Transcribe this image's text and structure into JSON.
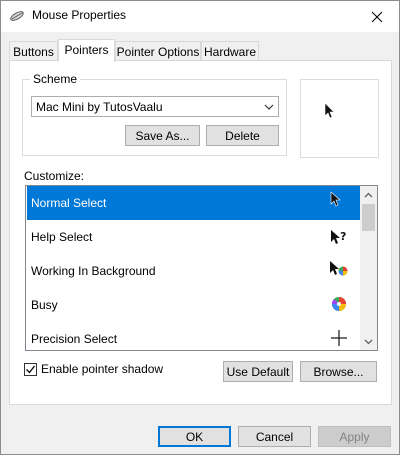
{
  "window": {
    "title": "Mouse Properties",
    "icons": {
      "app": "mouse-icon",
      "close": "close-icon"
    }
  },
  "tabs": [
    {
      "label": "Buttons",
      "active": false
    },
    {
      "label": "Pointers",
      "active": true
    },
    {
      "label": "Pointer Options",
      "active": false
    },
    {
      "label": "Hardware",
      "active": false
    }
  ],
  "scheme": {
    "legend": "Scheme",
    "selected": "Mac Mini by TutosVaalu",
    "save_as_label": "Save As...",
    "delete_label": "Delete"
  },
  "customize": {
    "label": "Customize:",
    "items": [
      {
        "label": "Normal Select",
        "cursor": "arrow-cursor-icon",
        "selected": true
      },
      {
        "label": "Help Select",
        "cursor": "help-cursor-icon",
        "selected": false
      },
      {
        "label": "Working In Background",
        "cursor": "working-cursor-icon",
        "selected": false
      },
      {
        "label": "Busy",
        "cursor": "busy-cursor-icon",
        "selected": false
      },
      {
        "label": "Precision Select",
        "cursor": "crosshair-cursor-icon",
        "selected": false
      }
    ]
  },
  "options": {
    "shadow_label": "Enable pointer shadow",
    "shadow_checked": true,
    "use_default_label": "Use Default",
    "browse_label": "Browse..."
  },
  "footer": {
    "ok_label": "OK",
    "cancel_label": "Cancel",
    "apply_label": "Apply"
  },
  "colors": {
    "accent": "#0078d7",
    "window_bg": "#f0f0f0"
  }
}
